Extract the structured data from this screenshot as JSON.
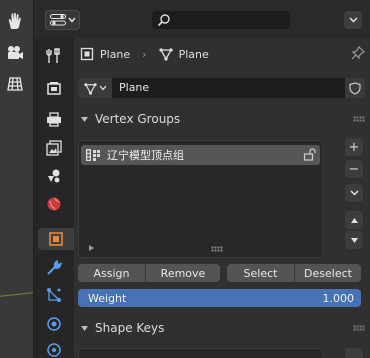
{
  "viewport": {
    "tools": [
      "hand-icon",
      "camera-icon",
      "grid-icon"
    ],
    "floor_line_color": "#6e8a3a"
  },
  "header": {
    "editor_type_icon": "properties-editor-icon",
    "search": {
      "value": "",
      "icon": "search-icon"
    }
  },
  "tabs": [
    "tool-tab-icon",
    "render-tab-icon",
    "output-tab-icon",
    "view-layer-tab-icon",
    "scene-tab-icon",
    "world-tab-icon",
    "object-tab-icon",
    "modifier-tab-icon",
    "particles-tab-icon",
    "physics-tab-icon",
    "constraints-tab-icon",
    "data-tab-icon"
  ],
  "breadcrumb": {
    "object": "Plane",
    "mesh": "Plane"
  },
  "datablock": {
    "name": "Plane"
  },
  "vertex_groups": {
    "title": "Vertex Groups",
    "items": [
      {
        "label": "辽宁模型顶点组"
      }
    ],
    "side_buttons": {
      "add": "+",
      "remove": "−"
    }
  },
  "buttons": {
    "assign": "Assign",
    "remove": "Remove",
    "select": "Select",
    "deselect": "Deselect"
  },
  "weight": {
    "label": "Weight",
    "value": "1.000",
    "color": "#4772b3"
  },
  "shape_keys": {
    "title": "Shape Keys"
  },
  "colors": {
    "annotation_arrow": "#e81ee0",
    "panel_bg": "#303030",
    "accent": "#4772b3"
  }
}
